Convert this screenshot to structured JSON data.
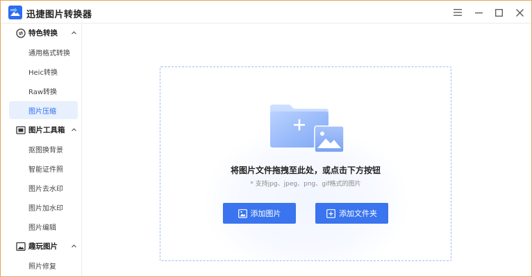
{
  "app": {
    "title": "迅捷图片转换器",
    "colors": {
      "accent": "#3a74ee",
      "border": "#e6a55a",
      "active_bg": "#e8f0fe"
    }
  },
  "window_controls": {
    "icons": [
      "menu-icon",
      "minimize-icon",
      "maximize-icon",
      "close-icon"
    ]
  },
  "sidebar": {
    "groups": [
      {
        "label": "特色转换",
        "icon": "convert-icon",
        "items": [
          {
            "label": "通用格式转换"
          },
          {
            "label": "Heic转换"
          },
          {
            "label": "Raw转换"
          },
          {
            "label": "图片压缩",
            "active": true
          }
        ]
      },
      {
        "label": "图片工具箱",
        "icon": "toolbox-icon",
        "items": [
          {
            "label": "抠图换背景"
          },
          {
            "label": "智能证件照"
          },
          {
            "label": "图片去水印"
          },
          {
            "label": "图片加水印"
          },
          {
            "label": "图片编辑"
          }
        ]
      },
      {
        "label": "趣玩图片",
        "icon": "image-fun-icon",
        "items": [
          {
            "label": "照片修复"
          }
        ]
      }
    ]
  },
  "main": {
    "drop_title": "将图片文件拖拽至此处，或点击下方按钮",
    "drop_hint": "* 支持jpg、jpeg、png、gif格式的图片",
    "add_image_label": "添加图片",
    "add_folder_label": "添加文件夹"
  }
}
